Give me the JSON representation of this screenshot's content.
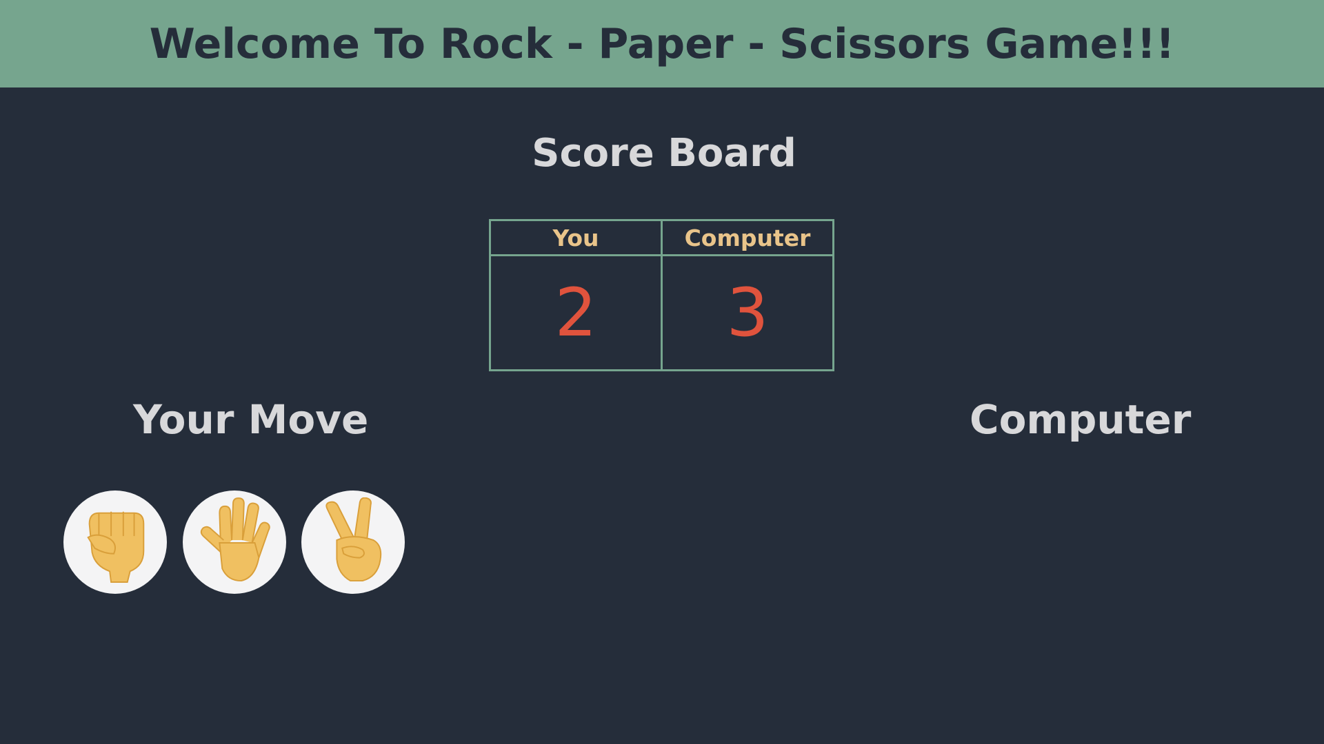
{
  "header": {
    "title": "Welcome To Rock - Paper - Scissors Game!!!"
  },
  "scoreboard": {
    "title": "Score Board",
    "columns": [
      "You",
      "Computer"
    ],
    "scores": [
      "2",
      "3"
    ]
  },
  "moves": {
    "player_label": "Your Move",
    "computer_label": "Computer",
    "choices": [
      {
        "name": "rock",
        "icon": "fist-icon"
      },
      {
        "name": "paper",
        "icon": "open-hand-icon"
      },
      {
        "name": "scissors",
        "icon": "victory-hand-icon"
      }
    ]
  },
  "colors": {
    "header_bg": "#76a58e",
    "page_bg": "#252d3a",
    "score_value": "#e0533d",
    "column_header": "#e9c48a",
    "hand": "#f0c061"
  }
}
